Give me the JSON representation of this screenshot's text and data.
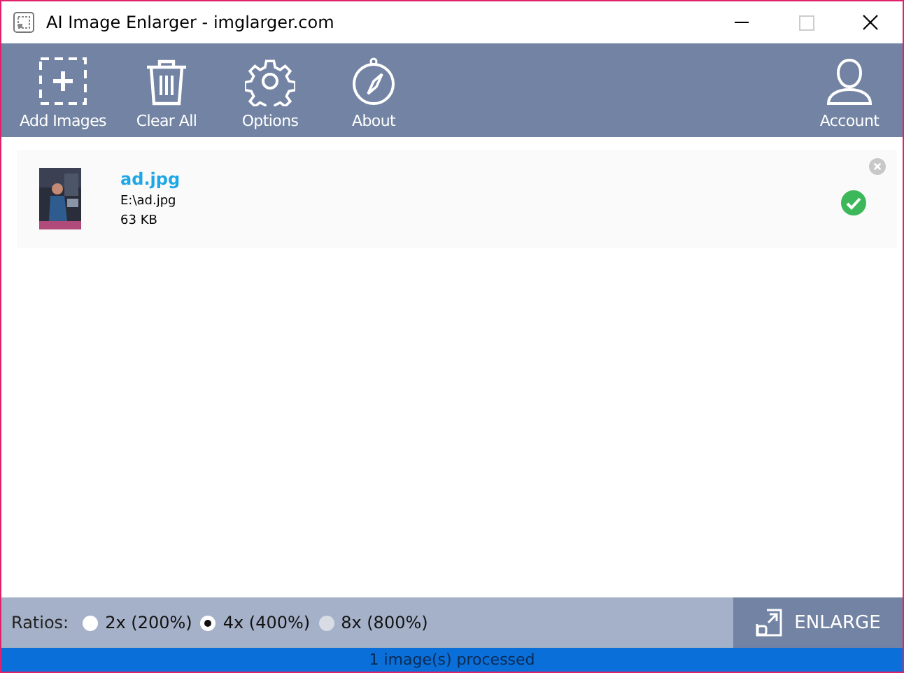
{
  "window": {
    "title": "AI Image Enlarger - imglarger.com"
  },
  "toolbar": [
    {
      "kind": "add",
      "label": "Add Images"
    },
    {
      "kind": "trash",
      "label": "Clear All"
    },
    {
      "kind": "gear",
      "label": "Options"
    },
    {
      "kind": "compass",
      "label": "About"
    },
    {
      "kind": "user",
      "label": "Account"
    }
  ],
  "files": [
    {
      "name": "ad.jpg",
      "path": "E:\\ad.jpg",
      "size": "63 KB",
      "done": true
    }
  ],
  "ratios": {
    "label": "Ratios:",
    "options": [
      {
        "label": "2x (200%)",
        "selected": false,
        "disabled": false
      },
      {
        "label": "4x (400%)",
        "selected": true,
        "disabled": false
      },
      {
        "label": "8x (800%)",
        "selected": false,
        "disabled": true
      }
    ]
  },
  "enlarge_button": {
    "label": "ENLARGE"
  },
  "status_bar": {
    "text": "1 image(s) processed"
  }
}
